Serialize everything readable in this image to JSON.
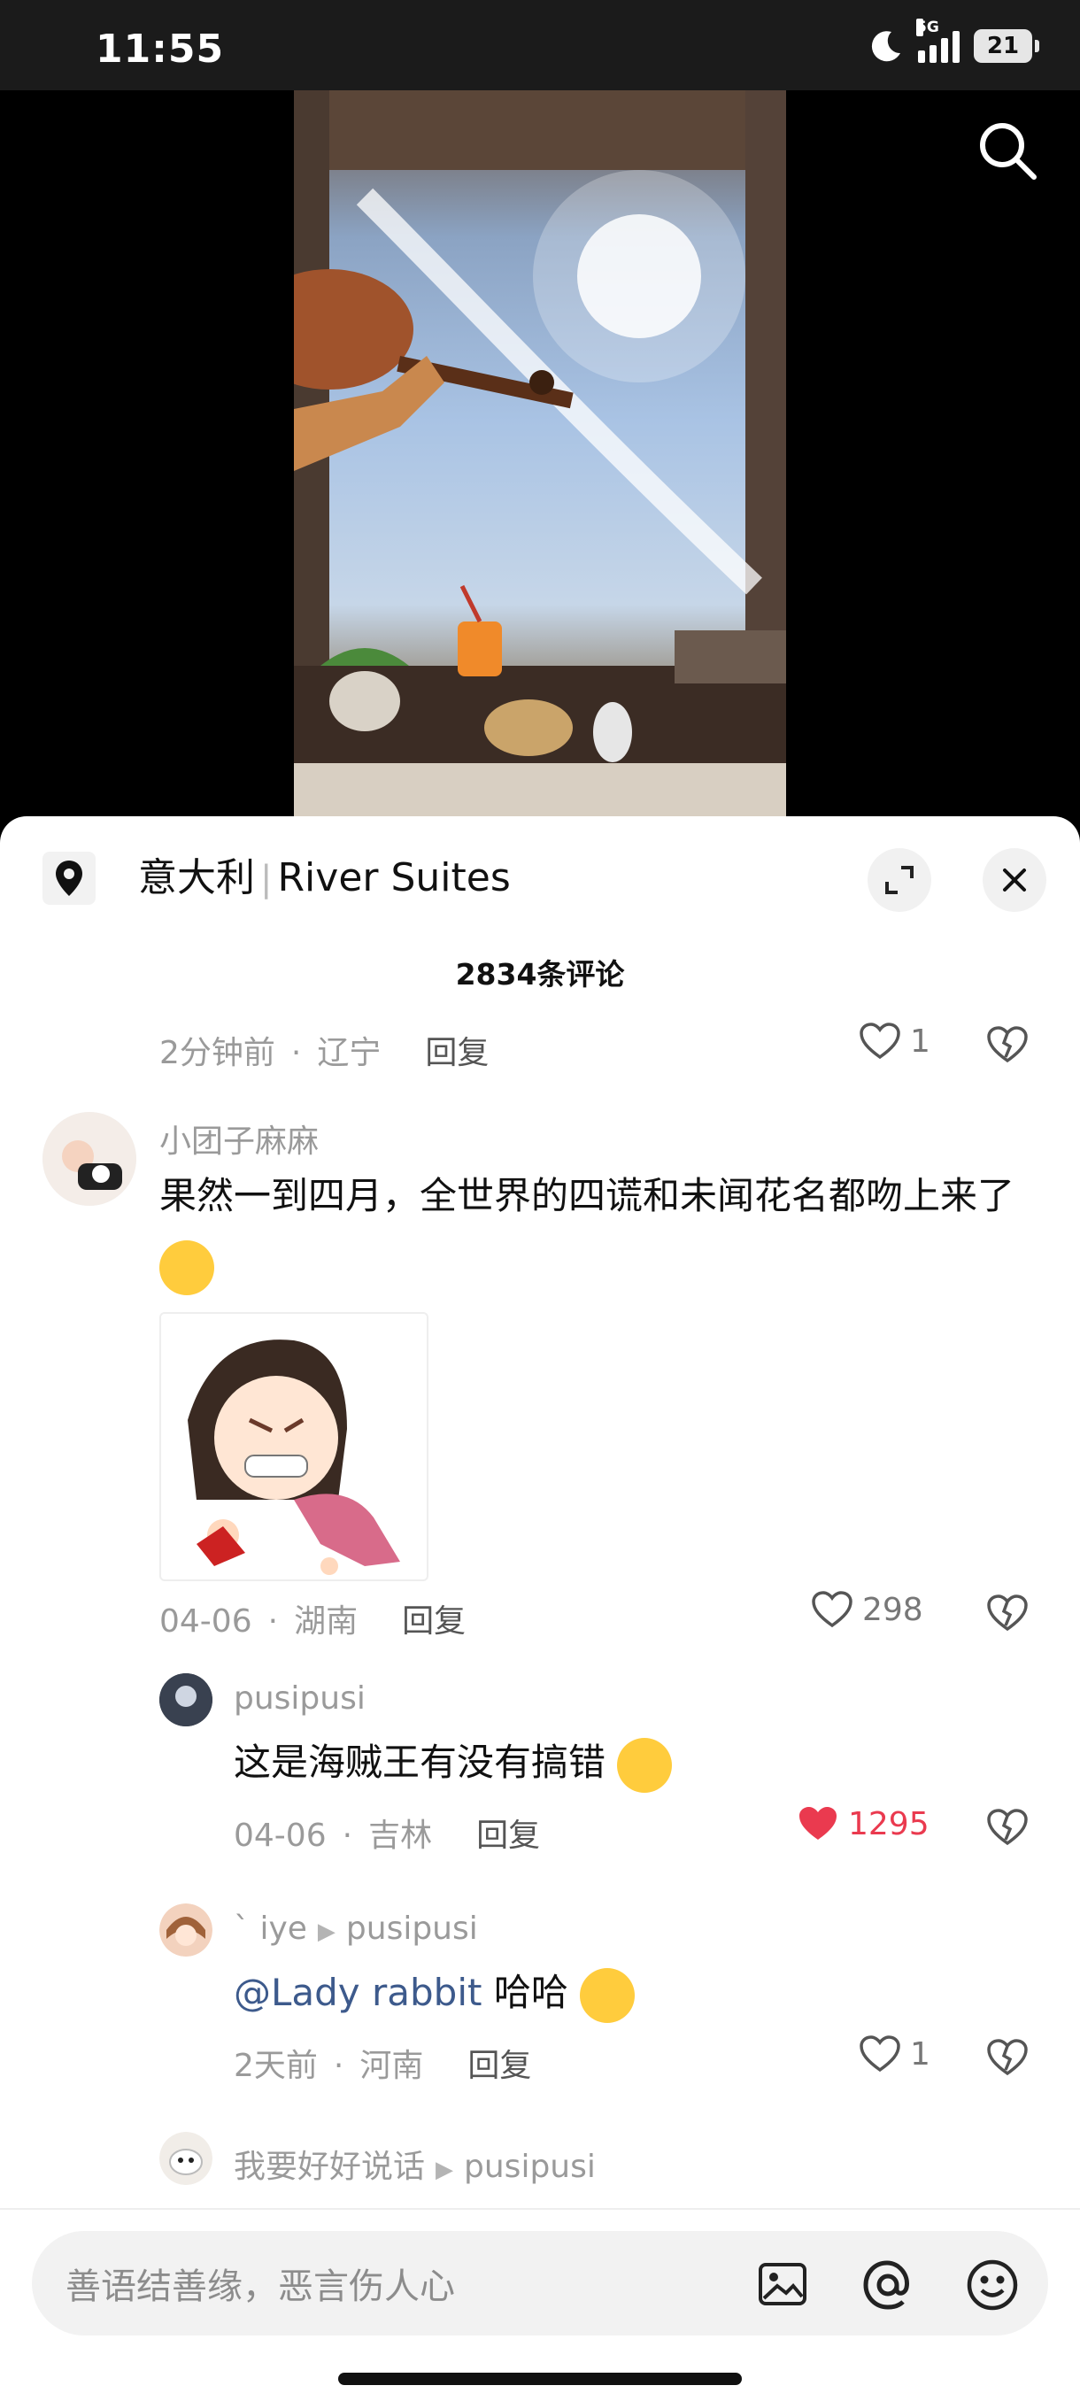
{
  "status_bar": {
    "time": "11:55",
    "network": "5G",
    "battery": "21"
  },
  "location": {
    "country": "意大利",
    "place": "River Suites"
  },
  "comments_count": "2834条评论",
  "top_meta": {
    "time": "2分钟前",
    "region": "辽宁",
    "reply": "回复",
    "likes": "1"
  },
  "comments": [
    {
      "user": "小团子麻麻",
      "text": "果然一到四月，全世界的四谎和未闻花名都吻上来了",
      "time": "04-06",
      "region": "湖南",
      "reply": "回复",
      "likes": "298"
    }
  ],
  "replies": [
    {
      "user": "pusipusi",
      "text": "这是海贼王有没有搞错",
      "time": "04-06",
      "region": "吉林",
      "reply": "回复",
      "likes": "1295",
      "liked": true
    },
    {
      "user": "` iye",
      "to": "pusipusi",
      "mention": "@Lady rabbit",
      "text": " 哈哈",
      "time": "2天前",
      "region": "河南",
      "reply": "回复",
      "likes": "1"
    },
    {
      "user": "我要好好说话",
      "to": "pusipusi"
    }
  ],
  "input": {
    "placeholder": "善语结善缘，恶言伤人心"
  },
  "colors": {
    "like_red": "#ea3a4f",
    "mention_blue": "#3d5a8c"
  },
  "icons": [
    "search-icon",
    "location-pin-icon",
    "expand-icon",
    "close-icon",
    "heart-icon",
    "dislike-icon",
    "image-icon",
    "at-icon",
    "emoji-icon"
  ]
}
